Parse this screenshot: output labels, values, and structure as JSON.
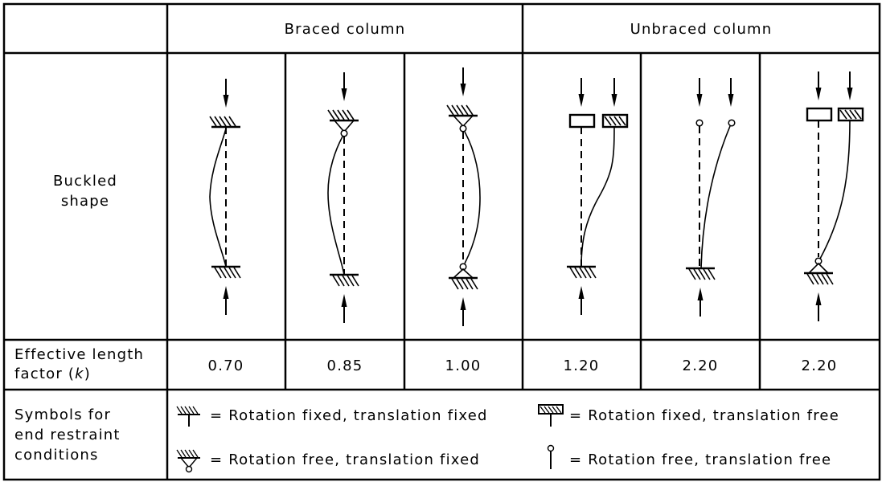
{
  "table": {
    "header": {
      "corner": "",
      "groups": [
        {
          "label": "Braced column",
          "span": 3
        },
        {
          "label": "Unbraced column",
          "span": 3
        }
      ]
    },
    "rows": {
      "buckled_shape": {
        "label_line1": "Buckled",
        "label_line2": "shape"
      },
      "effective_length": {
        "label_line1": "Effective length",
        "label_line2_prefix": "factor (",
        "label_line2_var": "k",
        "label_line2_suffix": ")",
        "values": [
          "0.70",
          "0.85",
          "1.00",
          "1.20",
          "2.20",
          "2.20"
        ]
      },
      "symbols": {
        "label_line1": "Symbols for",
        "label_line2": "end restraint",
        "label_line3": "conditions",
        "legend": [
          {
            "icon": "fixed-fixed-support-icon",
            "text": "= Rotation fixed, translation fixed"
          },
          {
            "icon": "fixed-free-support-icon",
            "text": "= Rotation fixed, translation free"
          },
          {
            "icon": "pinned-support-icon",
            "text": "= Rotation free, translation fixed"
          },
          {
            "icon": "free-end-icon",
            "text": "= Rotation free, translation free"
          }
        ]
      }
    },
    "cases": [
      {
        "group": "Braced column",
        "top": "fixed",
        "bottom": "fixed",
        "k": "0.70"
      },
      {
        "group": "Braced column",
        "top": "pinned",
        "bottom": "fixed",
        "k": "0.85"
      },
      {
        "group": "Braced column",
        "top": "pinned",
        "bottom": "pinned",
        "k": "1.00"
      },
      {
        "group": "Unbraced column",
        "top": "rotation-fixed-translation-free",
        "bottom": "fixed",
        "k": "1.20"
      },
      {
        "group": "Unbraced column",
        "top": "free",
        "bottom": "fixed",
        "k": "2.20"
      },
      {
        "group": "Unbraced column",
        "top": "rotation-fixed-translation-free",
        "bottom": "pinned",
        "k": "2.20"
      }
    ]
  }
}
